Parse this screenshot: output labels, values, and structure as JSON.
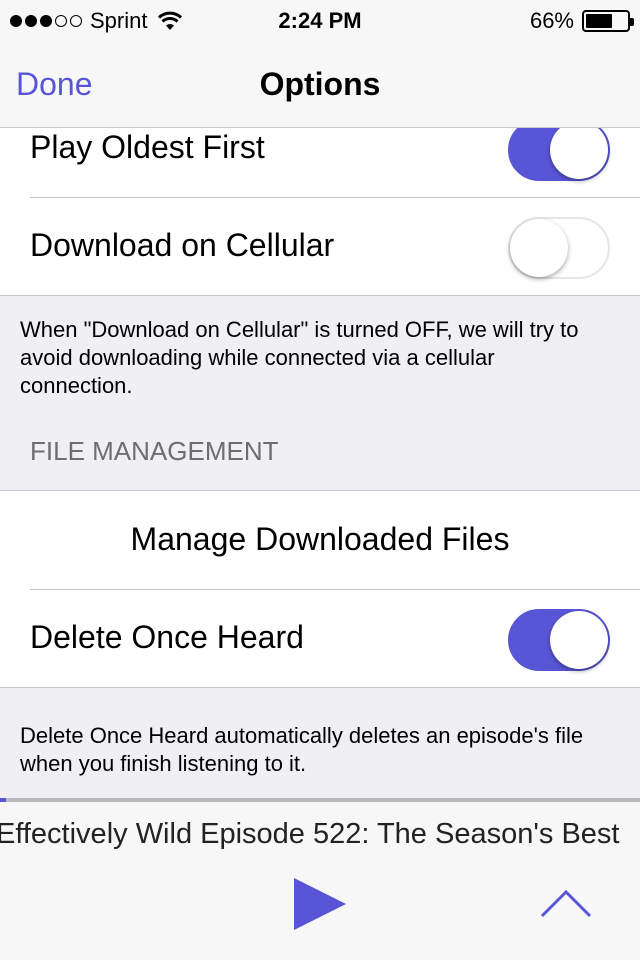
{
  "status_bar": {
    "carrier": "Sprint",
    "time": "2:24 PM",
    "battery": "66%",
    "battery_level": 0.66,
    "signal_bars": 3,
    "signal_total": 5
  },
  "nav": {
    "back_label": "Done",
    "title": "Options"
  },
  "rows": {
    "play_oldest_first": {
      "label": "Play Oldest First",
      "on": true
    },
    "download_on_cellular": {
      "label": "Download on Cellular",
      "on": false
    }
  },
  "cellular_footer": "When \"Download on Cellular\" is turned OFF, we will try to avoid downloading while connected via a cellular connection.",
  "file_management": {
    "header": "FILE MANAGEMENT",
    "manage_label": "Manage Downloaded Files",
    "delete_once_heard": {
      "label": "Delete Once Heard",
      "on": true
    },
    "footer": "Delete Once Heard automatically deletes an episode's file when you finish listening to it."
  },
  "player": {
    "episode_title": "Effectively Wild Episode 522: The Season's Best",
    "progress": 0.01
  },
  "colors": {
    "accent": "#5856d6",
    "background": "#efeff4",
    "separator": "#c8c7cc",
    "section_header": "#6d6d72"
  }
}
